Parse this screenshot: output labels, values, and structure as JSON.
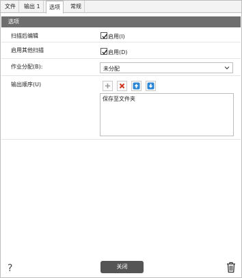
{
  "tabs": [
    {
      "label": "文件"
    },
    {
      "label": "输出 1"
    },
    {
      "label": "选项"
    },
    {
      "label": "常规"
    }
  ],
  "section": {
    "title": "选项"
  },
  "options": {
    "edit_after_scan": {
      "label": "扫描后编辑",
      "checkbox_label": "启用(I)",
      "checked": true
    },
    "enable_other_scan": {
      "label": "启用其他扫描",
      "checkbox_label": "启用(D)",
      "checked": true
    },
    "job_assign": {
      "label": "作业分配(B):",
      "value": "未分配"
    },
    "output_order": {
      "label": "输出顺序(U)",
      "items": [
        "保存至文件夹"
      ]
    }
  },
  "toolbar": {
    "add_icon": "plus-icon",
    "delete_icon": "delete-icon",
    "up_icon": "arrow-up-icon",
    "down_icon": "arrow-down-icon"
  },
  "footer": {
    "help": "?",
    "close_label": "关闭",
    "trash_icon": "trash-icon"
  },
  "colors": {
    "header_bg": "#6e6e6e",
    "close_bg": "#555555",
    "delete_red": "#d0311a",
    "arrow_blue": "#2b86d6"
  }
}
